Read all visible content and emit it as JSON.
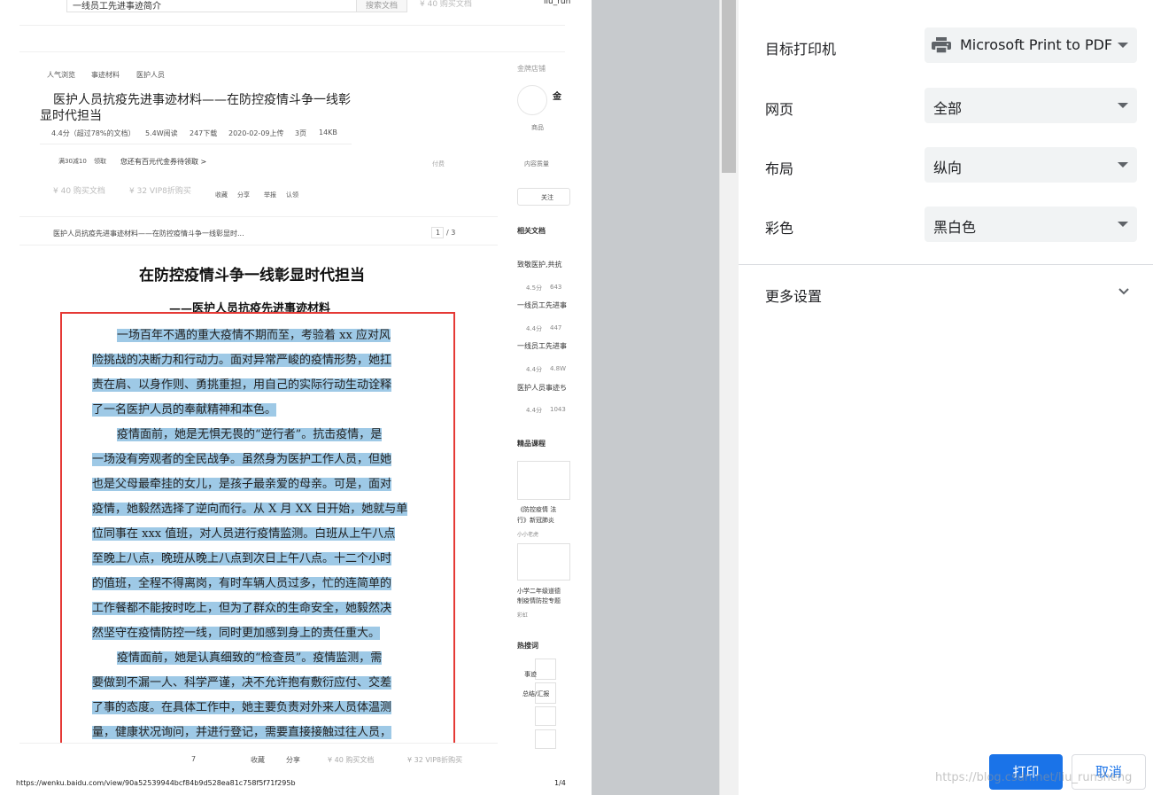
{
  "preview": {
    "topbar": {
      "search_text": "一线员工先进事迹简介",
      "search_btn": "搜索文档",
      "price": "¥ 40 购买文档",
      "user": "liu_run"
    },
    "tags": [
      "人气浏览",
      "事迹材料",
      "医护人员"
    ],
    "doc_title_line1": "医护人员抗疫先进事迹材料——在防控疫情斗争一线彰",
    "doc_title_line2": "显时代担当",
    "meta": [
      "4.4分（超过78%的文档）",
      "5.4W阅读",
      "247下载",
      "2020-02-09上传",
      "3页",
      "14KB"
    ],
    "coupon": {
      "left": "满30减10",
      "take": "领取",
      "more": "您还有百元代金券待领取 >",
      "pay": "付费"
    },
    "buy": {
      "doc": "¥ 40 购买文档",
      "vip": "¥ 32 VIP8折购买",
      "actions": [
        "收藏",
        "分享",
        "举报",
        "认领"
      ]
    },
    "page_bar": {
      "title": "医护人员抗疫先进事迹材料——在防控疫情斗争一线彰显时...",
      "page": "1",
      "total": "/ 3"
    },
    "heading": "在防控疫情斗争一线彰显时代担当",
    "subheading": "——医护人员抗疫先进事迹材料",
    "body_lines": [
      "一场百年不遇的重大疫情不期而至，考验着 xx 应对风",
      "险挑战的决断力和行动力。面对异常严峻的疫情形势，她扛",
      "责在肩、以身作则、勇挑重担，用自己的实际行动生动诠释",
      "了一名医护人员的奉献精神和本色。",
      "疫情面前，她是无惧无畏的“逆行者”。抗击疫情，是",
      "一场没有旁观者的全民战争。虽然身为医护工作人员，但她",
      "也是父母最牵挂的女儿，是孩子最亲爱的母亲。可是，面对",
      "疫情，她毅然选择了逆向而行。从 X 月 XX 日开始，她就与单",
      "位同事在 xxx 值班，对人员进行疫情监测。白班从上午八点",
      "至晚上八点，晚班从晚上八点到次日上午八点。十二个小时",
      "的值班，全程不得离岗，有时车辆人员过多，忙的连简单的",
      "工作餐都不能按时吃上，但为了群众的生命安全，她毅然决",
      "然坚守在疫情防控一线，同时更加感到身上的责任重大。",
      "疫情面前，她是认真细致的“检查员”。疫情监测，需",
      "要做到不漏一人、科学严谨，决不允许抱有敷衍应付、交差",
      "了事的态度。在具体工作中，她主要负责对外来人员体温测",
      "量，健康状况询问，并进行登记，需要直接接触过往人员，"
    ],
    "bottom_bar": {
      "num": "7",
      "fav": "收藏",
      "share": "分享",
      "buy": "¥ 40 购买文档",
      "vip": "¥ 32 VIP8折购买"
    },
    "url": "https://wenku.baidu.com/view/90a52539944bcf84b9d528ea81c758f5f71f295b",
    "page_count": "1/4",
    "right": {
      "shop": "金牌店铺",
      "shop_name": "金",
      "goods": "商品",
      "quality": "内容质量",
      "follow": "关注",
      "related": "相关文档",
      "related_items": [
        {
          "title": "致敬医护,共抗",
          "meta1": "4.5分",
          "meta2": "643"
        },
        {
          "title": "一线员工先进事",
          "meta1": "4.4分",
          "meta2": "447"
        },
        {
          "title": "一线员工先进事",
          "meta1": "4.4分",
          "meta2": "4.8W"
        },
        {
          "title": "医护人员事迹ち",
          "meta1": "4.4分",
          "meta2": "1043"
        }
      ],
      "courses": "精品课程",
      "course1_a": "《防控疫情 法",
      "course1_b": "行》新冠肺炎",
      "course1_author": "小小老虎",
      "course2_a": "小学二年级道德",
      "course2_b": "制疫情防控专题",
      "course2_author": "彩虹",
      "hot": "热搜词",
      "hot1": "事迹",
      "hot2": "总结/汇报"
    }
  },
  "settings": {
    "destination_label": "目标打印机",
    "destination_value": "Microsoft Print to PDF",
    "pages_label": "网页",
    "pages_value": "全部",
    "layout_label": "布局",
    "layout_value": "纵向",
    "color_label": "彩色",
    "color_value": "黑白色",
    "more_settings": "更多设置",
    "print_button": "打印",
    "cancel_button": "取消"
  },
  "watermark": "https://blog.csdn.net/liu_runsheng",
  "colors": {
    "accent": "#1a73e8",
    "highlight": "#9ec9e6",
    "annotation": "#e53935"
  }
}
